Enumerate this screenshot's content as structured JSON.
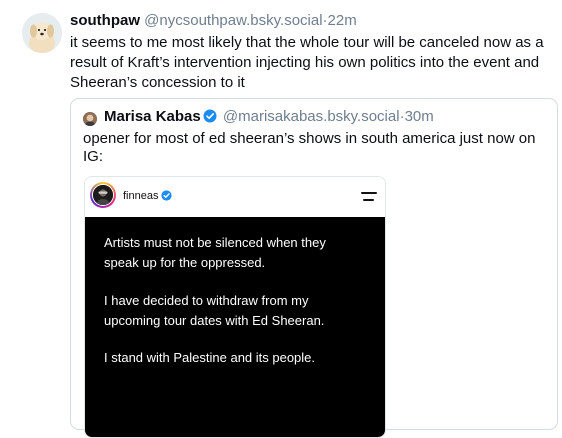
{
  "post": {
    "author_name": "southpaw",
    "author_handle": "@nycsouthpaw.bsky.social",
    "separator": "·",
    "timestamp": "22m",
    "text": "it seems to me most likely that the whole tour will be canceled now as a result of Kraft’s intervention injecting his own politics into the event and Sheeran’s concession to it",
    "avatar_icon": "puppy-avatar"
  },
  "quote": {
    "author_name": "Marisa Kabas",
    "author_handle": "@marisakabas.bsky.social",
    "separator": "·",
    "timestamp": "30m",
    "text": "opener for most of ed sheeran’s shows in south america just now on IG:",
    "verified_icon": "verified-badge-icon",
    "verified_color": "#1d8cf0"
  },
  "embed": {
    "username": "finneas",
    "menu_icon": "menu-icon",
    "story_lines": [
      "Artists must not be silenced when they",
      "speak up for the oppressed.",
      "I have decided to withdraw from my",
      "upcoming tour dates with Ed Sheeran.",
      "I stand with Palestine and its people."
    ],
    "story_background": "#000000"
  }
}
